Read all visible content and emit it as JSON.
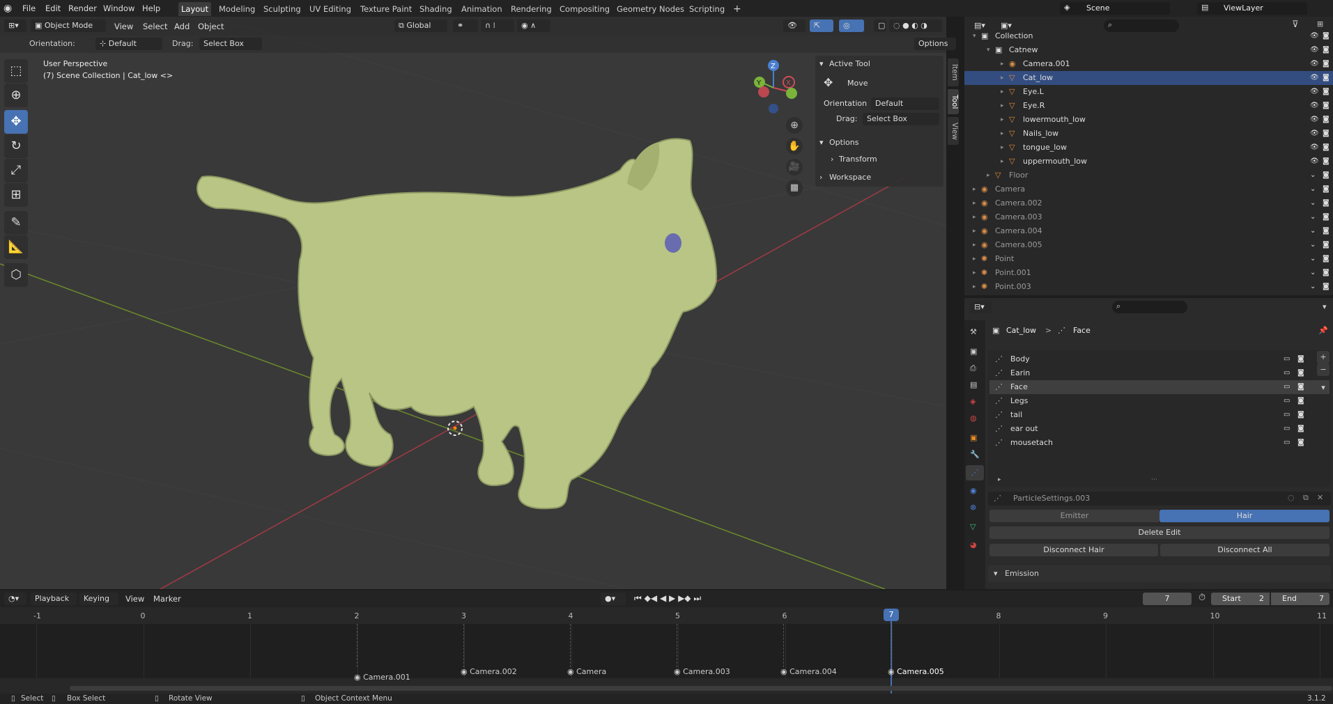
{
  "topbar": {
    "menus": [
      "File",
      "Edit",
      "Render",
      "Window",
      "Help"
    ],
    "workspaces": [
      "Layout",
      "Modeling",
      "Sculpting",
      "UV Editing",
      "Texture Paint",
      "Shading",
      "Animation",
      "Rendering",
      "Compositing",
      "Geometry Nodes",
      "Scripting"
    ],
    "active_workspace": "Layout",
    "add_tab": "+",
    "scene": "Scene",
    "view_layer": "ViewLayer"
  },
  "viewport": {
    "mode": "Object Mode",
    "menus": [
      "View",
      "Select",
      "Add",
      "Object"
    ],
    "transform_orientation": "Global",
    "orientation_label": "Orientation:",
    "orientation_value": "Default",
    "drag_label": "Drag:",
    "drag_value": "Select Box",
    "options_label": "Options",
    "perspective_label": "User Perspective",
    "collection_label": "(7) Scene Collection | Cat_low <>",
    "axis_labels": {
      "z": "Z",
      "y": "Y",
      "x": "X"
    }
  },
  "npanel": {
    "active_tool_title": "Active Tool",
    "tool_name": "Move",
    "orientation_label": "Orientation",
    "orientation_value": "Default",
    "drag_label": "Drag:",
    "drag_value": "Select Box",
    "options_title": "Options",
    "transform_label": "Transform",
    "workspace_label": "Workspace",
    "tabs": [
      "Item",
      "Tool",
      "View"
    ]
  },
  "outliner": {
    "rows": [
      {
        "name": "Collection",
        "indent": 0
      },
      {
        "name": "Catnew",
        "indent": 1
      },
      {
        "name": "Camera.001",
        "indent": 2
      },
      {
        "name": "Cat_low",
        "indent": 2
      },
      {
        "name": "Eye.L",
        "indent": 2
      },
      {
        "name": "Eye.R",
        "indent": 2
      },
      {
        "name": "lowermouth_low",
        "indent": 2
      },
      {
        "name": "Nails_low",
        "indent": 2
      },
      {
        "name": "tongue_low",
        "indent": 2
      },
      {
        "name": "uppermouth_low",
        "indent": 2
      },
      {
        "name": "Floor",
        "indent": 1
      },
      {
        "name": "Camera",
        "indent": 0
      },
      {
        "name": "Camera.002",
        "indent": 0
      },
      {
        "name": "Camera.003",
        "indent": 0
      },
      {
        "name": "Camera.004",
        "indent": 0
      },
      {
        "name": "Camera.005",
        "indent": 0
      },
      {
        "name": "Point",
        "indent": 0
      },
      {
        "name": "Point.001",
        "indent": 0
      },
      {
        "name": "Point.003",
        "indent": 0
      }
    ]
  },
  "properties": {
    "breadcrumb_object": "Cat_low",
    "breadcrumb_sep": ">",
    "breadcrumb_item": "Face",
    "vertex_groups": [
      "Body",
      "Earin",
      "Face",
      "Legs",
      "tail",
      "ear out",
      "mousetach"
    ],
    "selected_group": "Face",
    "particle_settings": "ParticleSettings.003",
    "emitter_label": "Emitter",
    "hair_label": "Hair",
    "delete_edit": "Delete Edit",
    "disconnect_hair": "Disconnect Hair",
    "disconnect_all": "Disconnect All",
    "emission_label": "Emission"
  },
  "timeline": {
    "menus": [
      "Playback",
      "Keying",
      "View",
      "Marker"
    ],
    "current_frame": "7",
    "start_label": "Start",
    "start_value": "2",
    "end_label": "End",
    "end_value": "7",
    "ticks": [
      "-1",
      "0",
      "1",
      "2",
      "3",
      "4",
      "5",
      "6",
      "7",
      "8",
      "9",
      "10",
      "11"
    ],
    "markers": [
      "Camera.001",
      "Camera.002",
      "Camera",
      "Camera.003",
      "Camera.004",
      "Camera.005"
    ]
  },
  "statusbar": {
    "select": "Select",
    "box_select": "Box Select",
    "rotate_view": "Rotate View",
    "context_menu": "Object Context Menu",
    "version": "3.1.2"
  }
}
